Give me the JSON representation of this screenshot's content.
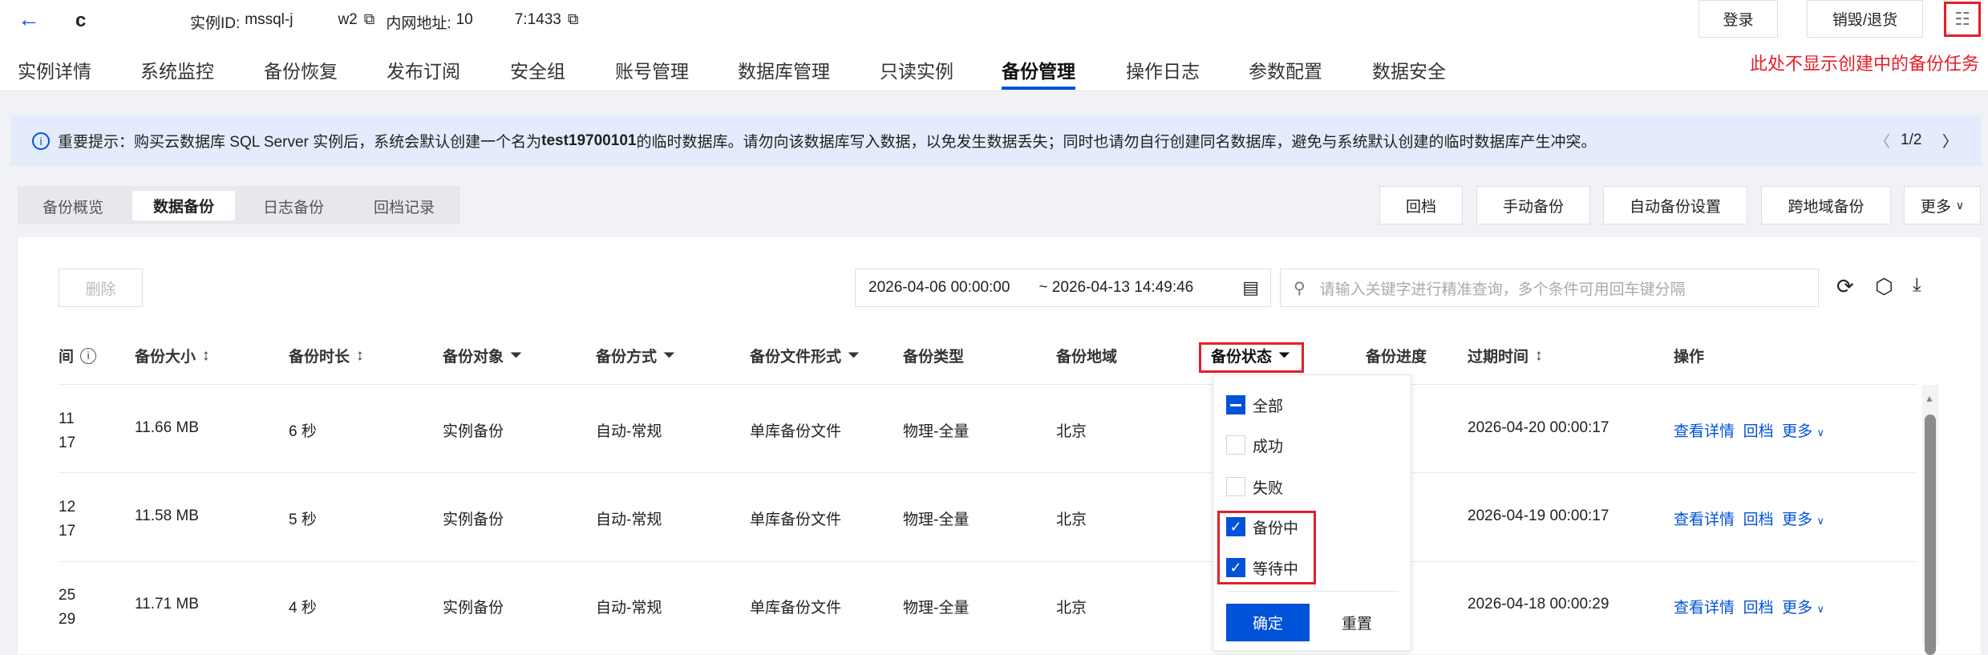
{
  "header": {
    "instance_name": "c",
    "instance_id_label": "实例ID:",
    "instance_id_start": "mssql-j",
    "instance_id_end": "w2",
    "address_label": "内网地址:",
    "address_start": "10",
    "address_end": "7:1433",
    "login": "登录",
    "destroy": "销毁/退货"
  },
  "tabs": [
    "实例详情",
    "系统监控",
    "备份恢复",
    "发布订阅",
    "安全组",
    "账号管理",
    "数据库管理",
    "只读实例",
    "备份管理",
    "操作日志",
    "参数配置",
    "数据安全"
  ],
  "annotation": "此处不显示创建中的备份任务",
  "banner": {
    "prefix": "重要提示：购买云数据库 SQL Server 实例后，系统会默认创建一个名为 ",
    "db": "test19700101",
    "suffix": " 的临时数据库。请勿向该数据库写入数据，以免发生数据丢失；同时也请勿自行创建同名数据库，避免与系统默认创建的临时数据库产生冲突。",
    "page": "1/2"
  },
  "subtabs": [
    "备份概览",
    "数据备份",
    "日志备份",
    "回档记录"
  ],
  "actions": [
    "回档",
    "手动备份",
    "自动备份设置",
    "跨地域备份",
    "更多"
  ],
  "toolbar": {
    "delete": "删除",
    "date_start": "2026-04-06 00:00:00",
    "date_end": "~ 2026-04-13 14:49:46",
    "search_placeholder": "请输入关键字进行精准查询，多个条件可用回车键分隔"
  },
  "columns": [
    "间",
    "备份大小",
    "备份时长",
    "备份对象",
    "备份方式",
    "备份文件形式",
    "备份类型",
    "备份地域",
    "备份状态",
    "备份进度",
    "过期时间",
    "操作"
  ],
  "rows": [
    {
      "t1": "11",
      "t2": "17",
      "size": "11.66 MB",
      "dur": "6 秒",
      "obj": "实例备份",
      "mode": "自动-常规",
      "form": "单库备份文件",
      "type": "物理-全量",
      "region": "北京",
      "expire": "2026-04-20 00:00:17"
    },
    {
      "t1": "12",
      "t2": "17",
      "size": "11.58 MB",
      "dur": "5 秒",
      "obj": "实例备份",
      "mode": "自动-常规",
      "form": "单库备份文件",
      "type": "物理-全量",
      "region": "北京",
      "expire": "2026-04-19 00:00:17"
    },
    {
      "t1": "25",
      "t2": "29",
      "size": "11.71 MB",
      "dur": "4 秒",
      "obj": "实例备份",
      "mode": "自动-常规",
      "form": "单库备份文件",
      "type": "物理-全量",
      "region": "北京",
      "expire": "2026-04-18 00:00:29"
    }
  ],
  "ops": {
    "detail": "查看详情",
    "rollback": "回档",
    "more": "更多"
  },
  "filter": {
    "options": [
      {
        "label": "全部",
        "state": "indeterminate"
      },
      {
        "label": "成功",
        "state": "unchecked"
      },
      {
        "label": "失败",
        "state": "unchecked"
      },
      {
        "label": "备份中",
        "state": "checked"
      },
      {
        "label": "等待中",
        "state": "checked"
      }
    ],
    "confirm": "确定",
    "reset": "重置"
  },
  "colors": {
    "accent": "#0052d9",
    "annotation": "#e41e26"
  }
}
